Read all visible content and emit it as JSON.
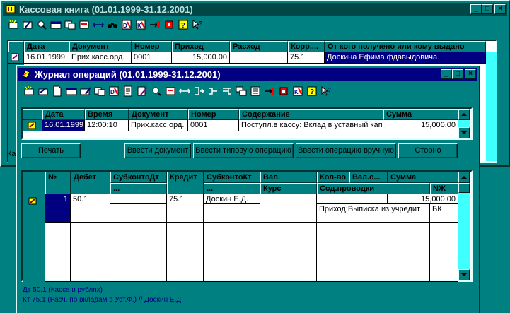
{
  "main_window": {
    "title": "Кассовая книга  (01.01.1999-31.12.2001)",
    "columns": [
      "Дата",
      "Документ",
      "Номер",
      "Приход",
      "Расход",
      "Корр....",
      "От кого получено или кому выдано"
    ],
    "row": {
      "date": "16.01.1999",
      "doc": "Прих.касс.орд.",
      "num": "0001",
      "income": "15,000.00",
      "expense": "",
      "corr": "75.1",
      "whom": "Доскина Ефима фдавыдовича"
    },
    "bottom_fragment": "Ка"
  },
  "journal_window": {
    "title": "Журнал операций  (01.01.1999-31.12.2001)",
    "columns": [
      "Дата",
      "Время",
      "Документ",
      "Номер",
      "Содержание",
      "Сумма"
    ],
    "row": {
      "date": "16.01.1999",
      "time": "12:00:10",
      "doc": "Прих.касс.орд.",
      "num": "0001",
      "content": "Поступл.в кассу: Вклад в уставный кап",
      "sum": "15,000.00"
    },
    "buttons": {
      "print": "Печать",
      "enter_doc": "Ввести документ",
      "enter_typical": "Ввести типовую операцию",
      "enter_manual": "Ввести операцию вручную",
      "storno": "Сторно"
    },
    "entries_columns": {
      "n": "№",
      "debit": "Дебет",
      "sub_dt": "СубконтоДт",
      "sub_dt2": "...",
      "credit": "Кредит",
      "sub_kt": "СубконтоКт",
      "sub_kt2": "...",
      "cur": "Вал.",
      "rate": "Курс",
      "qty": "Кол-во",
      "cur_sum": "Вал.с...",
      "sum": "Сумма",
      "content": "Сод.проводки",
      "nj": "NЖ"
    },
    "entry": {
      "n": "1",
      "debit": "50.1",
      "credit": "75.1",
      "sub_kt": "Доскин Е.Д.",
      "sum": "15,000.00",
      "content": "Приход:Выписка из учредит",
      "nj": "БК"
    },
    "status_dt": "Дт 50.1 (Касса в рублях)",
    "status_kt": "Кт 75.1 (Расч. по вкладам в Уст.Ф.) // Доскин Е.Д."
  },
  "colors": {
    "desktop": "#008080",
    "title_active": "#000080",
    "selection": "#000080",
    "scroll_track": "#40ffff"
  }
}
